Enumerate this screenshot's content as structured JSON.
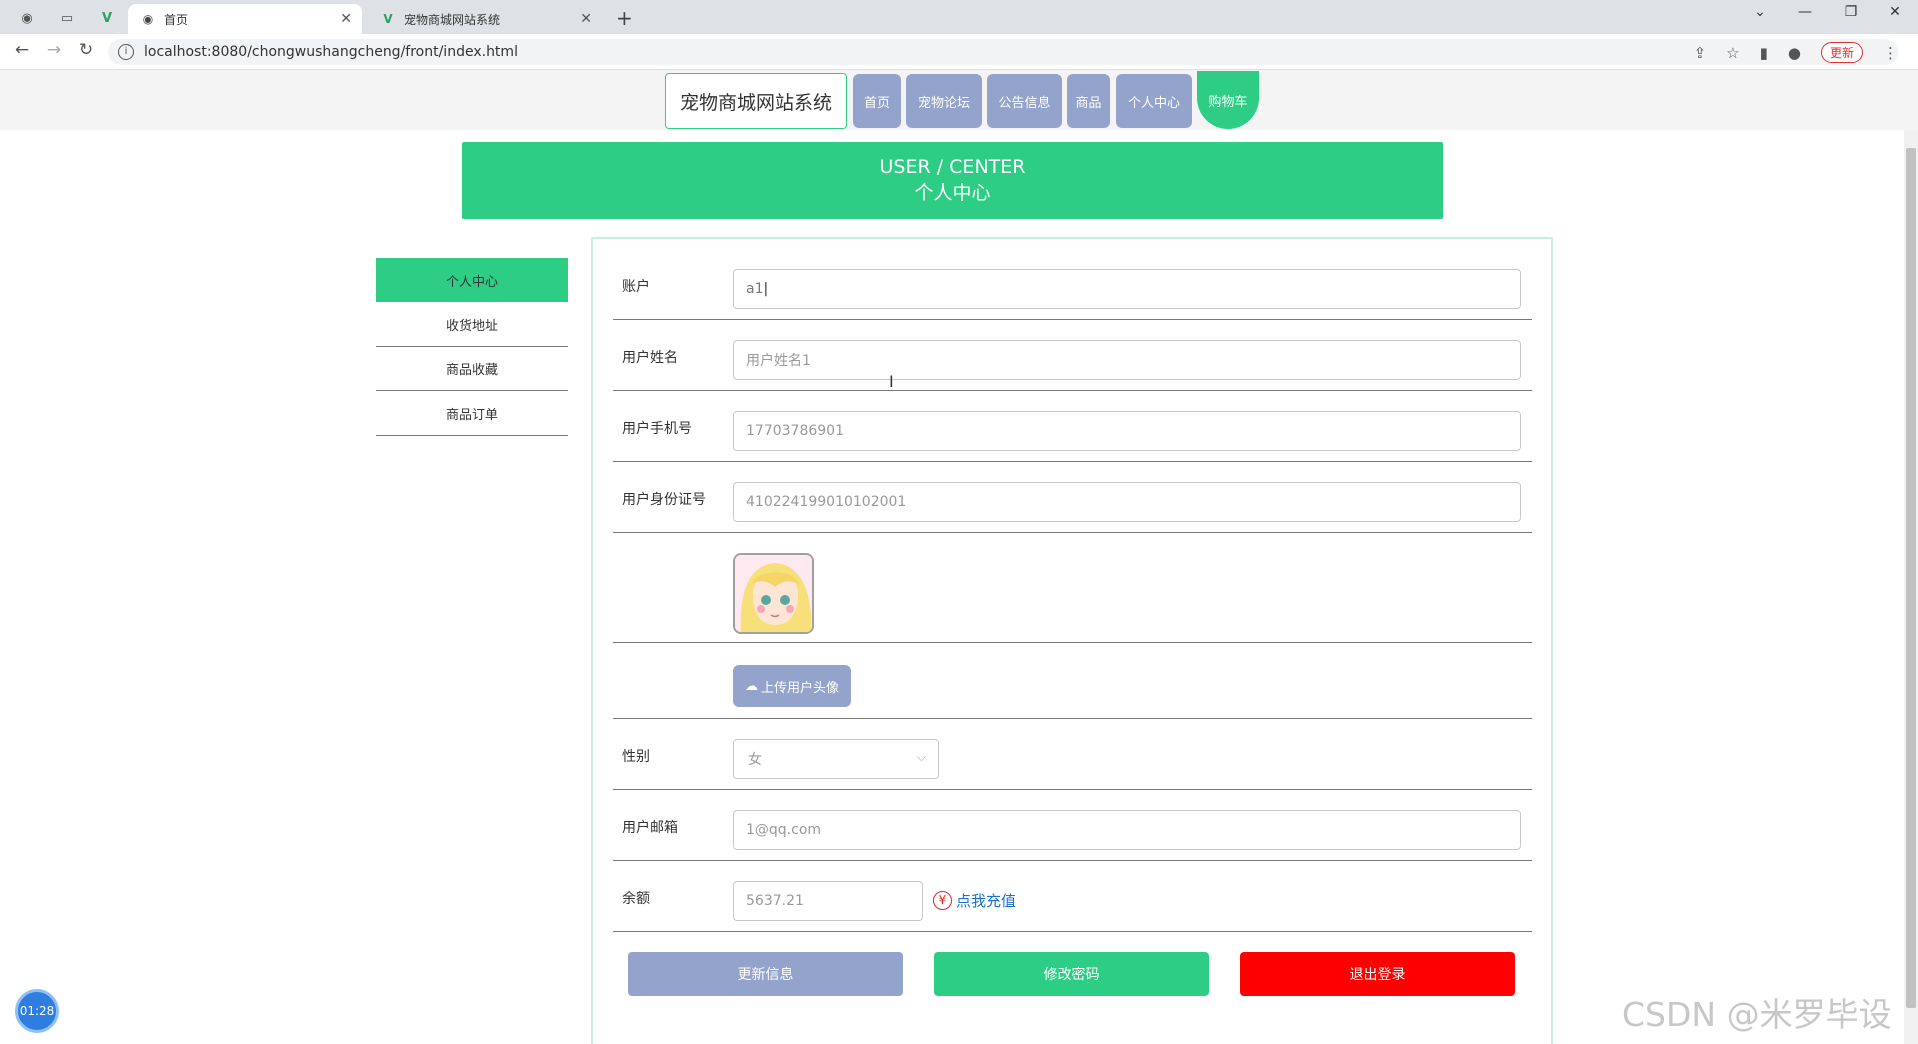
{
  "browser": {
    "tabs": [
      {
        "title": "首页",
        "active": true
      },
      {
        "title": "宠物商城网站系统",
        "active": false
      }
    ],
    "url": "localhost:8080/chongwushangcheng/front/index.html",
    "update_label": "更新"
  },
  "header": {
    "site_title": "宠物商城网站系统",
    "nav": [
      "首页",
      "宠物论坛",
      "公告信息",
      "商品",
      "个人中心"
    ],
    "cart_label": "购物车"
  },
  "banner": {
    "english": "USER / CENTER",
    "chinese": "个人中心"
  },
  "sidebar": {
    "items": [
      "个人中心",
      "收货地址",
      "商品收藏",
      "商品订单"
    ],
    "active_index": 0
  },
  "form": {
    "account": {
      "label": "账户",
      "value": "a1"
    },
    "username": {
      "label": "用户姓名",
      "value": "用户姓名1"
    },
    "phone": {
      "label": "用户手机号",
      "value": "17703786901"
    },
    "id_number": {
      "label": "用户身份证号",
      "value": "410224199010102001"
    },
    "upload_label": "上传用户头像",
    "gender": {
      "label": "性别",
      "value": "女"
    },
    "email": {
      "label": "用户邮箱",
      "value": "1@qq.com"
    },
    "balance": {
      "label": "余额",
      "value": "5637.21",
      "recharge_label": "点我充值"
    }
  },
  "actions": {
    "update": "更新信息",
    "change_password": "修改密码",
    "logout": "退出登录"
  },
  "overlay": {
    "timer": "01:28",
    "watermark": "CSDN @米罗毕设"
  },
  "colors": {
    "accent_green": "#2ecd85",
    "nav_blue": "#94a3cb",
    "logout_red": "#ff0000"
  }
}
